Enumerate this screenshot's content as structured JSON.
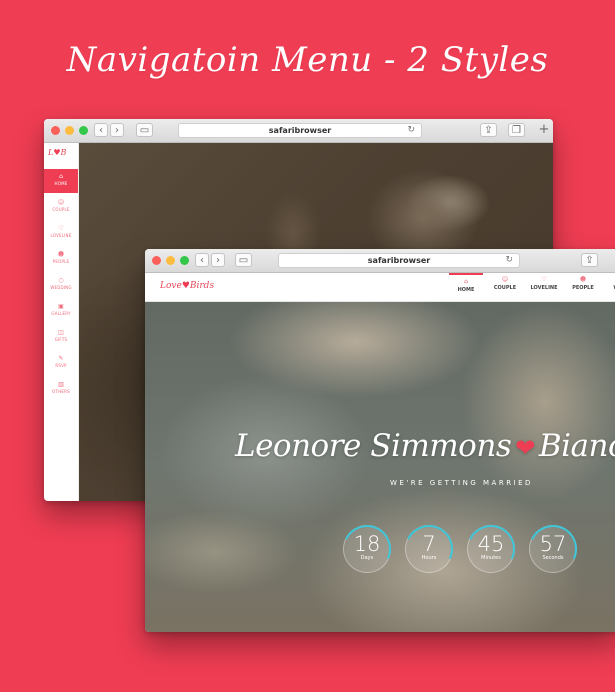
{
  "headline": "Navigatoin Menu - 2 Styles",
  "browser1": {
    "url": "safaribrowser",
    "logo": "LB",
    "sidebar_items": [
      {
        "label": "HOME",
        "icon": "home-icon",
        "glyph": "⌂",
        "active": true
      },
      {
        "label": "COUPLE",
        "icon": "couple-icon",
        "glyph": "☺",
        "active": false
      },
      {
        "label": "LOVELINE",
        "icon": "heart-icon",
        "glyph": "♡",
        "active": false
      },
      {
        "label": "PEOPLE",
        "icon": "people-icon",
        "glyph": "☻",
        "active": false
      },
      {
        "label": "WEDDING",
        "icon": "rings-icon",
        "glyph": "○",
        "active": false
      },
      {
        "label": "GALLERY",
        "icon": "camera-icon",
        "glyph": "▣",
        "active": false
      },
      {
        "label": "GIFTS",
        "icon": "gift-icon",
        "glyph": "◫",
        "active": false
      },
      {
        "label": "RSVP",
        "icon": "pen-icon",
        "glyph": "✎",
        "active": false
      },
      {
        "label": "OTHERS",
        "icon": "others-icon",
        "glyph": "▥",
        "active": false
      }
    ]
  },
  "browser2": {
    "url": "safaribrowser",
    "logo": {
      "left": "Love",
      "right": "Birds"
    },
    "nav_items": [
      {
        "label": "HOME",
        "icon": "home-icon",
        "glyph": "⌂",
        "active": true
      },
      {
        "label": "COUPLE",
        "icon": "couple-icon",
        "glyph": "☺",
        "active": false
      },
      {
        "label": "LOVELINE",
        "icon": "heart-icon",
        "glyph": "♡",
        "active": false
      },
      {
        "label": "PEOPLE",
        "icon": "people-icon",
        "glyph": "☻",
        "active": false
      },
      {
        "label": "WEDD",
        "icon": "rings-icon",
        "glyph": "○",
        "active": false
      }
    ],
    "hero": {
      "name_left": "Leonore Simmons",
      "name_right": "Bianca Paw",
      "tagline": "WE'RE GETTING MARRIED",
      "countdown": [
        {
          "value": "18",
          "unit": "Days"
        },
        {
          "value": "7",
          "unit": "Hours"
        },
        {
          "value": "45",
          "unit": "Minutes"
        },
        {
          "value": "57",
          "unit": "Seconds"
        }
      ]
    }
  },
  "colors": {
    "background": "#ef3d53",
    "accent": "#ef3d53",
    "countdown_ring": "#3ec6d8"
  }
}
